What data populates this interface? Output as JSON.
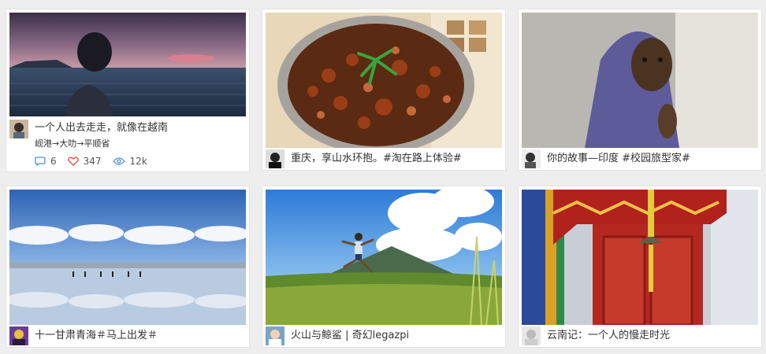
{
  "cards": [
    {
      "title": "一个人出去走走，就像在越南",
      "subtitle": "岘港→大叻→平顺省",
      "stats": {
        "comments": "6",
        "likes": "347",
        "views": "12k"
      },
      "image": "sunset-sea-silhouette"
    },
    {
      "title": "重庆，享山水环抱。#淘在路上体验#",
      "image": "hotpot-dish"
    },
    {
      "title": "你的故事—印度 #校园旅型家#",
      "image": "girl-in-headscarf"
    },
    {
      "title": "十一甘肃青海＃马上出发＃",
      "image": "salt-lake-reflection"
    },
    {
      "title": "火山与鲸鲨 | 奇幻legazpi",
      "image": "volcano-jumping-man"
    },
    {
      "title": "云南记：一个人的慢走时光",
      "image": "red-door-bell"
    }
  ],
  "colors": {
    "accent": "#4a90e2",
    "like": "#e64a4a"
  }
}
